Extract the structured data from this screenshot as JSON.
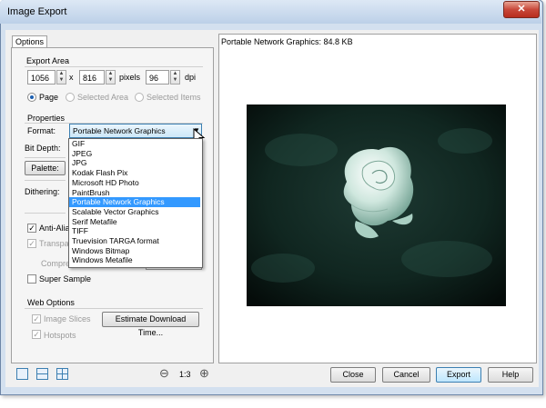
{
  "window": {
    "title": "Image Export",
    "close_glyph": "✕"
  },
  "tabs": {
    "options": "Options"
  },
  "export_area": {
    "label": "Export Area",
    "width": "1056",
    "x_sep": "x",
    "height": "816",
    "unit": "pixels",
    "dpi_value": "96",
    "dpi_label": "dpi",
    "radio_page": "Page",
    "radio_selected_area": "Selected Area",
    "radio_selected_items": "Selected Items"
  },
  "properties": {
    "label": "Properties",
    "format_label": "Format:",
    "format_value": "Portable Network Graphics",
    "bit_depth_label": "Bit Depth:",
    "palette_button": "Palette:",
    "dithering_label": "Dithering:"
  },
  "format_options": [
    "GIF",
    "JPEG",
    "JPG",
    "Kodak Flash Pix",
    "Microsoft HD Photo",
    "PaintBrush",
    "Portable Network Graphics",
    "Scalable Vector Graphics",
    "Serif Metafile",
    "TIFF",
    "Truevision TARGA format",
    "Windows Bitmap",
    "Windows Metafile"
  ],
  "options": {
    "anti_alias": "Anti-Alia",
    "transparent": "Transpa",
    "compression": "Compre",
    "super_sample": "Super Sample"
  },
  "web_options": {
    "label": "Web Options",
    "image_slices": "Image Slices",
    "hotspots": "Hotspots",
    "estimate_button": "Estimate Download Time..."
  },
  "preview": {
    "info": "Portable Network Graphics:  84.8 KB"
  },
  "zoom": {
    "level": "1:3",
    "minus_glyph": "⊖",
    "plus_glyph": "⊕"
  },
  "buttons": {
    "close": "Close",
    "cancel": "Cancel",
    "export": "Export",
    "help": "Help"
  },
  "colors": {
    "selection": "#3399ff",
    "window_frame": "#bcd0e8",
    "close_button": "#c8483a"
  }
}
